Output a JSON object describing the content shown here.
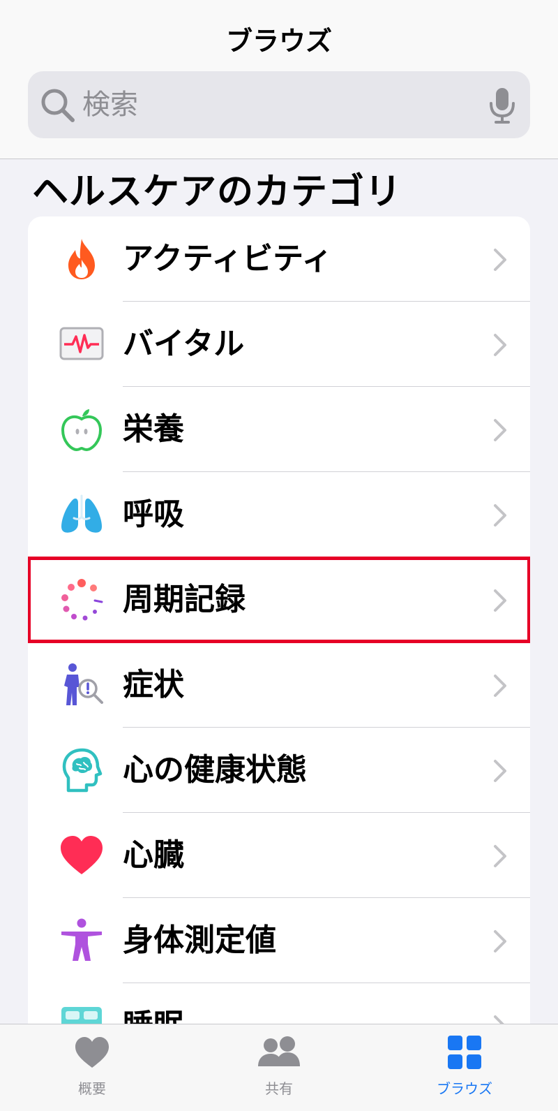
{
  "nav": {
    "title": "ブラウズ"
  },
  "search": {
    "placeholder": "検索"
  },
  "section": {
    "title": "ヘルスケアのカテゴリ"
  },
  "categories": [
    {
      "label": "アクティビティ",
      "icon": "flame-icon"
    },
    {
      "label": "バイタル",
      "icon": "vitals-monitor-icon"
    },
    {
      "label": "栄養",
      "icon": "apple-icon"
    },
    {
      "label": "呼吸",
      "icon": "lungs-icon"
    },
    {
      "label": "周期記録",
      "icon": "cycle-dots-icon",
      "highlighted": true
    },
    {
      "label": "症状",
      "icon": "symptom-figure-icon"
    },
    {
      "label": "心の健康状態",
      "icon": "head-brain-icon"
    },
    {
      "label": "心臓",
      "icon": "heart-icon"
    },
    {
      "label": "身体測定値",
      "icon": "body-figure-icon"
    },
    {
      "label": "睡眠",
      "icon": "bed-icon"
    }
  ],
  "tabs": [
    {
      "label": "概要",
      "icon": "heart-tab-icon",
      "active": false
    },
    {
      "label": "共有",
      "icon": "people-icon",
      "active": false
    },
    {
      "label": "ブラウズ",
      "icon": "grid-icon",
      "active": true
    }
  ],
  "colors": {
    "highlight": "#e60026",
    "accent": "#1977f3",
    "activity": "#ff5a1f",
    "vitals": "#ff2d55",
    "nutrition": "#34c759",
    "respiratory": "#32ade6",
    "cycle": "#ff6b6b",
    "symptoms": "#5856d6",
    "mental": "#30c0c0",
    "heart": "#ff2d55",
    "body": "#af52de",
    "sleep": "#5ed6d6"
  }
}
